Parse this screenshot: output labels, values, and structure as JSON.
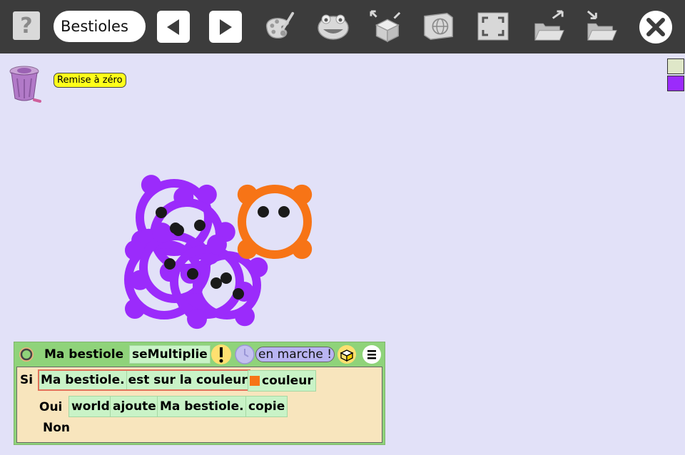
{
  "toolbar": {
    "help_glyph": "?",
    "project_name": "Bestioles",
    "icons": [
      "help-icon",
      "previous-icon",
      "next-icon",
      "paint-icon",
      "character-icon",
      "object-box-icon",
      "world-icon",
      "fullscreen-icon",
      "open-folder-icon",
      "save-folder-icon",
      "close-icon"
    ]
  },
  "world": {
    "reset_label": "Remise à zéro"
  },
  "panel": {
    "title": "Ma bestiole",
    "script_name": "seMultiplie",
    "status": "en marche !",
    "keyword_if": "Si",
    "condition_object": "Ma bestiole.",
    "condition_test": "est sur la couleur",
    "condition_color_label": "couleur",
    "condition_color": "#f77416",
    "keyword_yes": "Oui",
    "yes_target": "world",
    "yes_action": "ajoute",
    "yes_object": "Ma bestiole.",
    "yes_method": "copie",
    "keyword_no": "Non"
  },
  "colors": {
    "creature_purple": "#9b2bfb",
    "creature_orange": "#f77416",
    "background": "#e2e1f8",
    "panel_green": "#8fd37a",
    "script_bg": "#f8e5bd"
  }
}
